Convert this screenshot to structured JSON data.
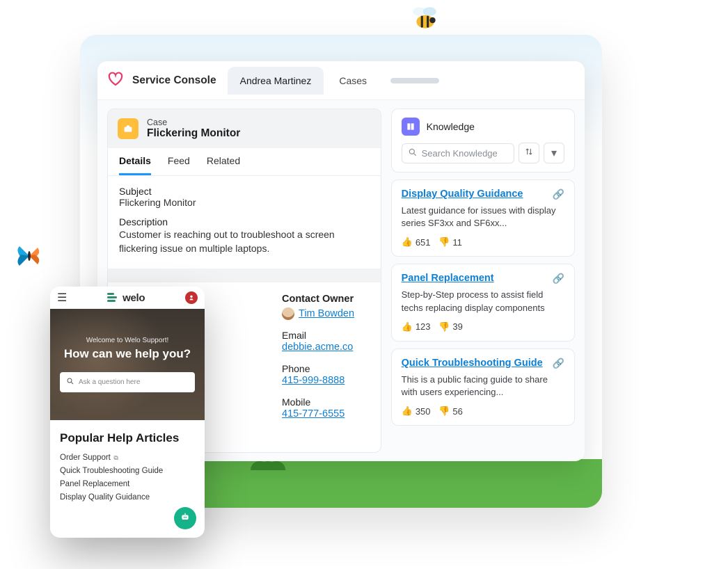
{
  "brand": {
    "title": "Service Console"
  },
  "tabs": {
    "active": "Andrea Martinez",
    "second": "Cases"
  },
  "case": {
    "eyebrow": "Case",
    "title": "Flickering Monitor",
    "subtabs": {
      "details": "Details",
      "feed": "Feed",
      "related": "Related"
    },
    "subject_label": "Subject",
    "subject_value": "Flickering Monitor",
    "description_label": "Description",
    "description_value": "Customer is reaching out to troubleshoot a screen flickering issue on multiple laptops."
  },
  "contact": {
    "owner_label": "Contact Owner",
    "owner_name": "Tim Bowden",
    "email_label": "Email",
    "email_value": "debbie.acme.co",
    "phone_label": "Phone",
    "phone_value": "415-999-8888",
    "mobile_label": "Mobile",
    "mobile_value": "415-777-6555"
  },
  "knowledge": {
    "title": "Knowledge",
    "search_placeholder": "Search Knowledge",
    "articles": [
      {
        "title": "Display Quality Guidance",
        "desc": "Latest guidance for issues with display series SF3xx and SF6xx...",
        "up": "651",
        "down": "11"
      },
      {
        "title": "Panel Replacement",
        "desc": "Step-by-Step process to assist field techs replacing display components",
        "up": "123",
        "down": "39"
      },
      {
        "title": "Quick Troubleshooting Guide",
        "desc": "This is a public facing guide to share with users experiencing...",
        "up": "350",
        "down": "56"
      }
    ]
  },
  "mobile": {
    "brand": "welo",
    "hero_eyebrow": "Welcome to Welo Support!",
    "hero_title": "How can we help you?",
    "search_placeholder": "Ask a question here",
    "section_title": "Popular Help Articles",
    "links": {
      "order": "Order Support",
      "quick": "Quick Troubleshooting Guide",
      "panel": "Panel Replacement",
      "display": "Display Quality Guidance"
    }
  }
}
